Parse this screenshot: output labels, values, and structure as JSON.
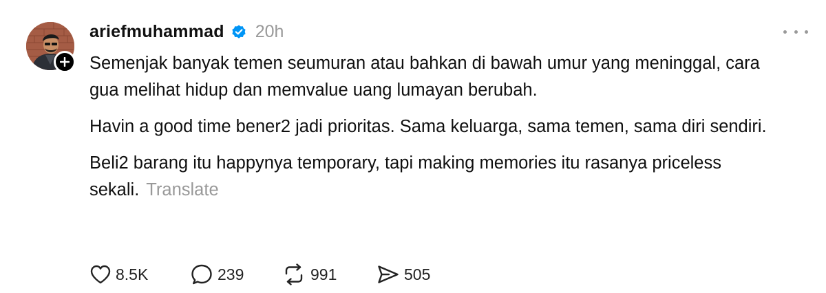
{
  "post": {
    "username": "ariefmuhammad",
    "timestamp": "20h",
    "paragraphs": [
      "Semenjak banyak temen seumuran atau bahkan di bawah umur yang meninggal, cara gua melihat hidup dan memvalue uang lumayan berubah.",
      "Havin a good time bener2 jadi prioritas. Sama keluarga, sama temen, sama diri sendiri.",
      "Beli2 barang itu happynya temporary, tapi making memories itu rasanya priceless sekali."
    ],
    "translate_label": "Translate"
  },
  "actions": {
    "likes": "8.5K",
    "replies": "239",
    "reposts": "991",
    "shares": "505"
  },
  "icons": {
    "verified": "verified-badge-icon",
    "follow": "plus-icon",
    "more": "more-horizontal-icon",
    "like": "heart-icon",
    "reply": "comment-icon",
    "repost": "repost-icon",
    "share": "send-icon"
  },
  "colors": {
    "verified_blue": "#0095f6",
    "muted_text": "#999999",
    "primary_text": "#101010"
  }
}
